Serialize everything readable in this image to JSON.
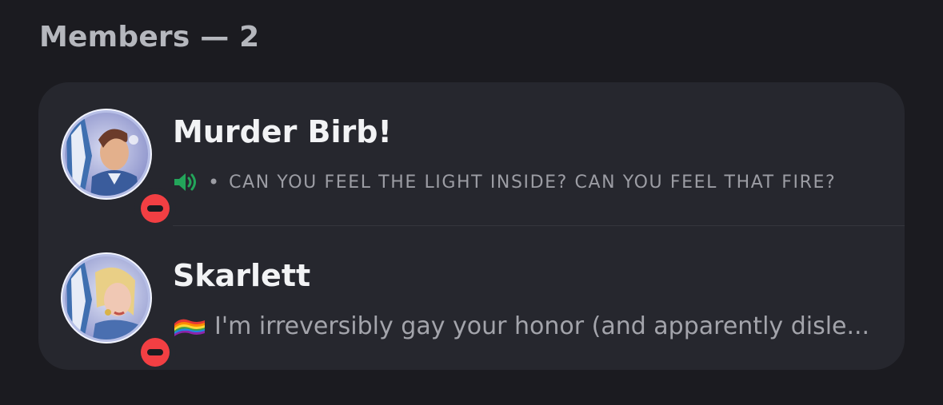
{
  "members_section": {
    "header": "Members — 2"
  },
  "members": [
    {
      "name": "Murder Birb!",
      "status": "dnd",
      "activity_icon": "speaker-icon",
      "status_text": "CAN YOU FEEL THE LIGHT INSIDE? CAN YOU FEEL THAT FIRE?"
    },
    {
      "name": "Skarlett",
      "status": "dnd",
      "activity_icon": "rainbow-flag-icon",
      "status_text": "I'm irreversibly gay your honor (and apparently disle..."
    }
  ],
  "colors": {
    "background": "#1b1b20",
    "card": "#26272e",
    "dnd": "#f23f43",
    "speaker": "#23a55a"
  }
}
